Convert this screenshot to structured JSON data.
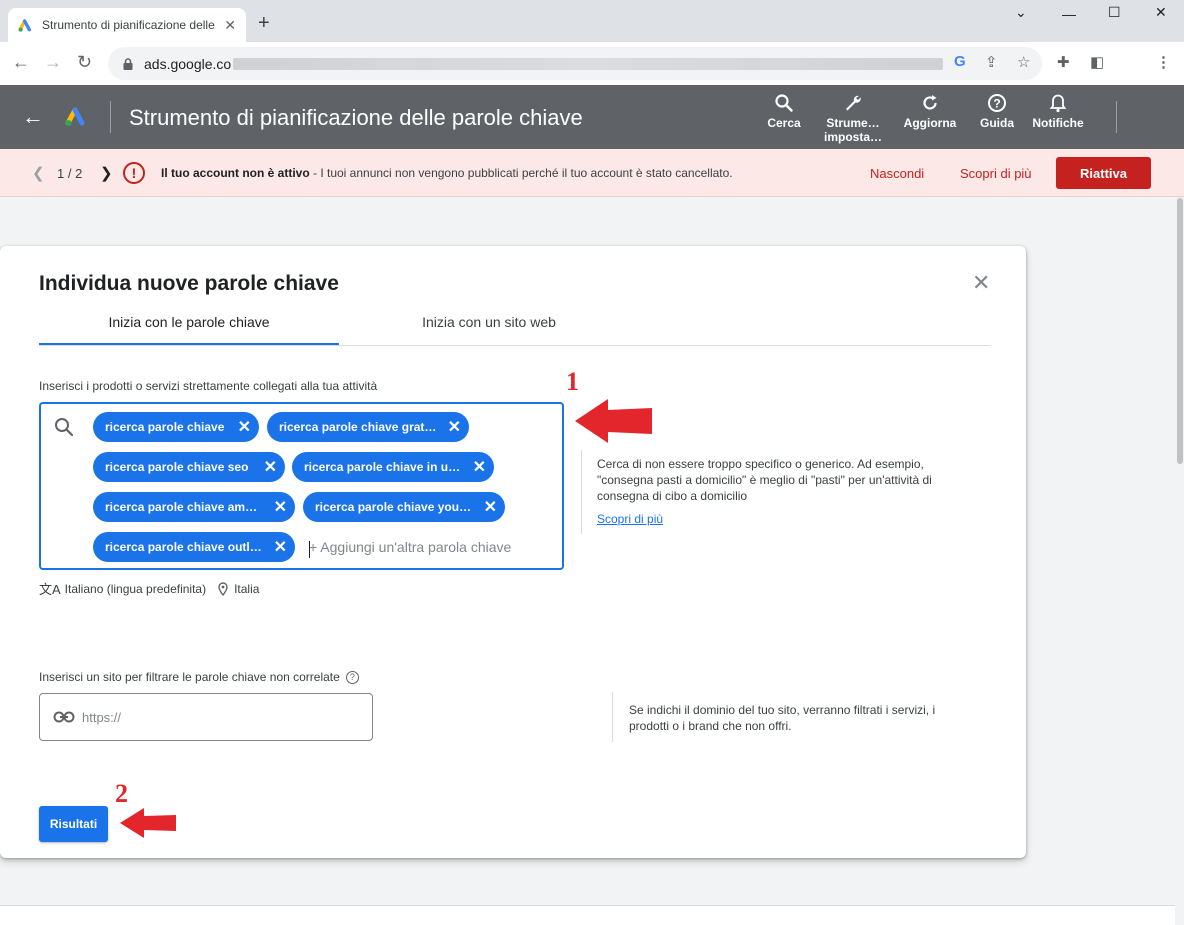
{
  "browser": {
    "tab_title": "Strumento di pianificazione delle",
    "url_prefix": "ads.google.co",
    "new_tab": "+",
    "close_tab": "✕",
    "window_controls": {
      "menu": "⌄",
      "minimize": "—",
      "maximize": "☐",
      "close": "✕"
    }
  },
  "header": {
    "title": "Strumento di pianificazione delle parole chiave",
    "buttons": [
      {
        "label": "Cerca"
      },
      {
        "label": "Strume… imposta…"
      },
      {
        "label": "Aggiorna"
      },
      {
        "label": "Guida"
      },
      {
        "label": "Notifiche"
      }
    ]
  },
  "banner": {
    "pagination": "1 / 2",
    "message_bold": "Il tuo account non è attivo",
    "message_rest": " - I tuoi annunci non vengono pubblicati perché il tuo account è stato cancellato.",
    "hide": "Nascondi",
    "learn_more": "Scopri di più",
    "reactivate": "Riattiva",
    "error_color": "#c5221f"
  },
  "dialog": {
    "title": "Individua nuove parole chiave",
    "tabs": [
      {
        "label": "Inizia con le parole chiave"
      },
      {
        "label": "Inizia con un sito web"
      }
    ],
    "keywords_label": "Inserisci i prodotti o servizi strettamente collegati alla tua attività",
    "chips": [
      "ricerca parole chiave",
      "ricerca parole chiave grat…",
      "ricerca parole chiave seo",
      "ricerca parole chiave in u…",
      "ricerca parole chiave am…",
      "ricerca parole chiave you…",
      "ricerca parole chiave outl…"
    ],
    "add_keyword_placeholder": "+ Aggiungi un'altra parola chiave",
    "language": "Italiano (lingua predefinita)",
    "location": "Italia",
    "hint_keywords": "Cerca di non essere troppo specifico o generico. Ad esempio, \"consegna pasti a domicilio\" è meglio di \"pasti\" per un'attività di consegna di cibo a domicilio",
    "hint_link": "Scopri di più",
    "site_label": "Inserisci un sito per filtrare le parole chiave non correlate",
    "site_placeholder": "https://",
    "hint_site": "Se indichi il dominio del tuo sito, verranno filtrati i servizi, i prodotti o i brand che non offri.",
    "results_button": "Risultati",
    "accent": "#1a73e8"
  },
  "annotations": {
    "step1": "1",
    "step2": "2",
    "color": "#e3262b"
  }
}
